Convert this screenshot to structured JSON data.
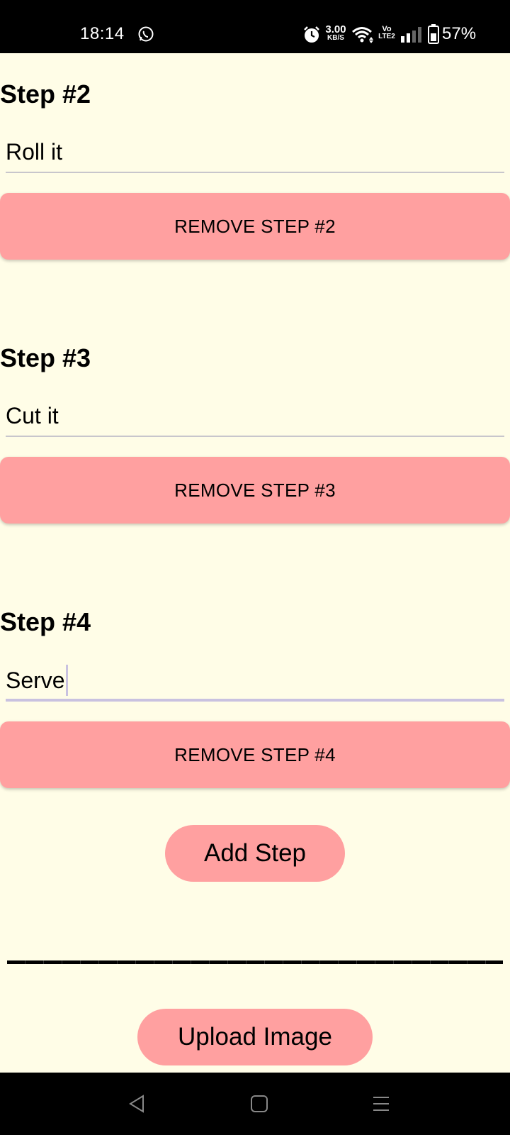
{
  "status_bar": {
    "time": "18:14",
    "net_speed_value": "3.00",
    "net_speed_unit": "KB/S",
    "volte_top": "Vo",
    "volte_bottom": "LTE2",
    "battery": "57%"
  },
  "steps": [
    {
      "title": "Step #2",
      "value": "Roll it",
      "remove_label": "REMOVE STEP #2"
    },
    {
      "title": "Step #3",
      "value": "Cut it",
      "remove_label": "REMOVE STEP #3"
    },
    {
      "title": "Step #4",
      "value": "Serve",
      "remove_label": "REMOVE STEP #4"
    }
  ],
  "actions": {
    "add_step_label": "Add Step",
    "upload_image_label": "Upload Image"
  },
  "colors": {
    "background": "#fffde7",
    "button": "#ffa0a0",
    "focus_underline": "#c9c2e0"
  }
}
